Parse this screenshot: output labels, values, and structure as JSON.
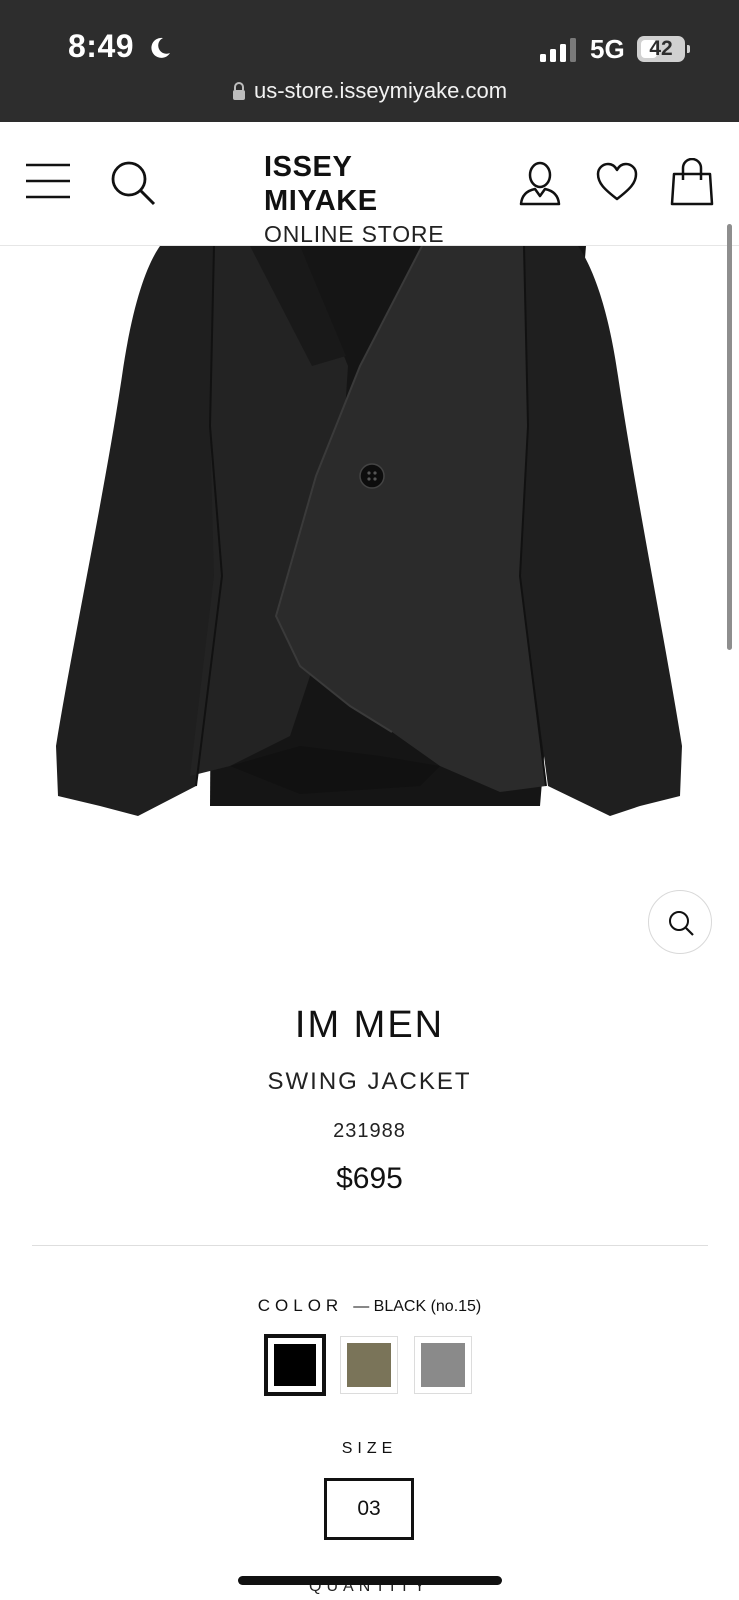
{
  "status_bar": {
    "time": "8:49",
    "network": "5G",
    "battery": "42",
    "url": "us-store.isseymiyake.com"
  },
  "header": {
    "brand_name": "ISSEY MIYAKE",
    "brand_sub": "ONLINE STORE",
    "icons": [
      "menu-icon",
      "search-icon",
      "account-icon",
      "heart-icon",
      "bag-icon"
    ]
  },
  "product": {
    "brand": "IM MEN",
    "name": "SWING JACKET",
    "code": "231988",
    "price": "$695",
    "color_label": "COLOR",
    "color_value": "— BLACK (no.15)",
    "colors": [
      {
        "name": "black",
        "hex": "#000000",
        "selected": true
      },
      {
        "name": "olive",
        "hex": "#7a7459",
        "selected": false
      },
      {
        "name": "gray",
        "hex": "#8a8a8a",
        "selected": false
      }
    ],
    "size_label": "SIZE",
    "size_value": "03",
    "quantity_label": "QUANTITY"
  },
  "colors": {
    "status_bar_bg": "#2d2d2d",
    "jacket": "#1c1c1c"
  }
}
